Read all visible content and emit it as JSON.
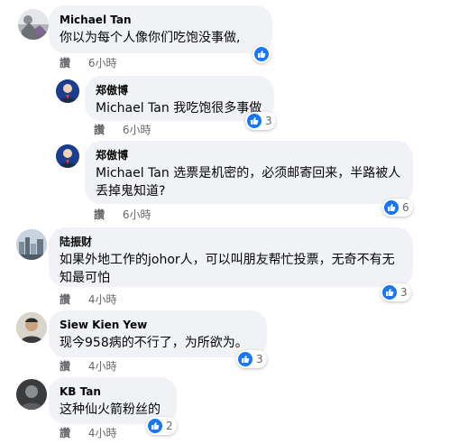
{
  "comments": [
    {
      "author": "Michael Tan",
      "text": "你以为每个人像你们吃饱没事做,",
      "reply_label": "讚",
      "time": "6小時",
      "reactions": null,
      "has_like_badge": true,
      "avatar_icon": "avatar-landscape"
    },
    {
      "author": "郑傲博",
      "text": "Michael Tan 我吃饱很多事做",
      "reply_label": "讚",
      "time": "6小時",
      "reactions": "3",
      "avatar_icon": "avatar-portrait"
    },
    {
      "author": "郑傲博",
      "text": "Michael Tan 选票是机密的，必须邮寄回来，半路被人丢掉鬼知道?",
      "reply_label": "讚",
      "time": "6小時",
      "reactions": "6",
      "avatar_icon": "avatar-portrait"
    },
    {
      "author": "陆振财",
      "text": "如果外地工作的johor人，可以叫朋友帮忙投票，无奇不有无知最可怕",
      "reply_label": "讚",
      "time": "4小時",
      "reactions": "3",
      "avatar_icon": "avatar-cityscape"
    },
    {
      "author": "Siew Kien Yew",
      "text": "现今958病的不行了，为所欲为。",
      "reply_label": "讚",
      "time": "4小時",
      "reactions": "3",
      "avatar_icon": "avatar-person"
    },
    {
      "author": "KB Tan",
      "text": "这种仙火箭粉丝的",
      "reply_label": "讚",
      "time": "4小時",
      "reactions": "2",
      "avatar_icon": "avatar-dark"
    }
  ],
  "colors": {
    "bubble_bg": "#f0f2f5",
    "like_blue": "#1877f2",
    "meta_gray": "#65676b"
  }
}
